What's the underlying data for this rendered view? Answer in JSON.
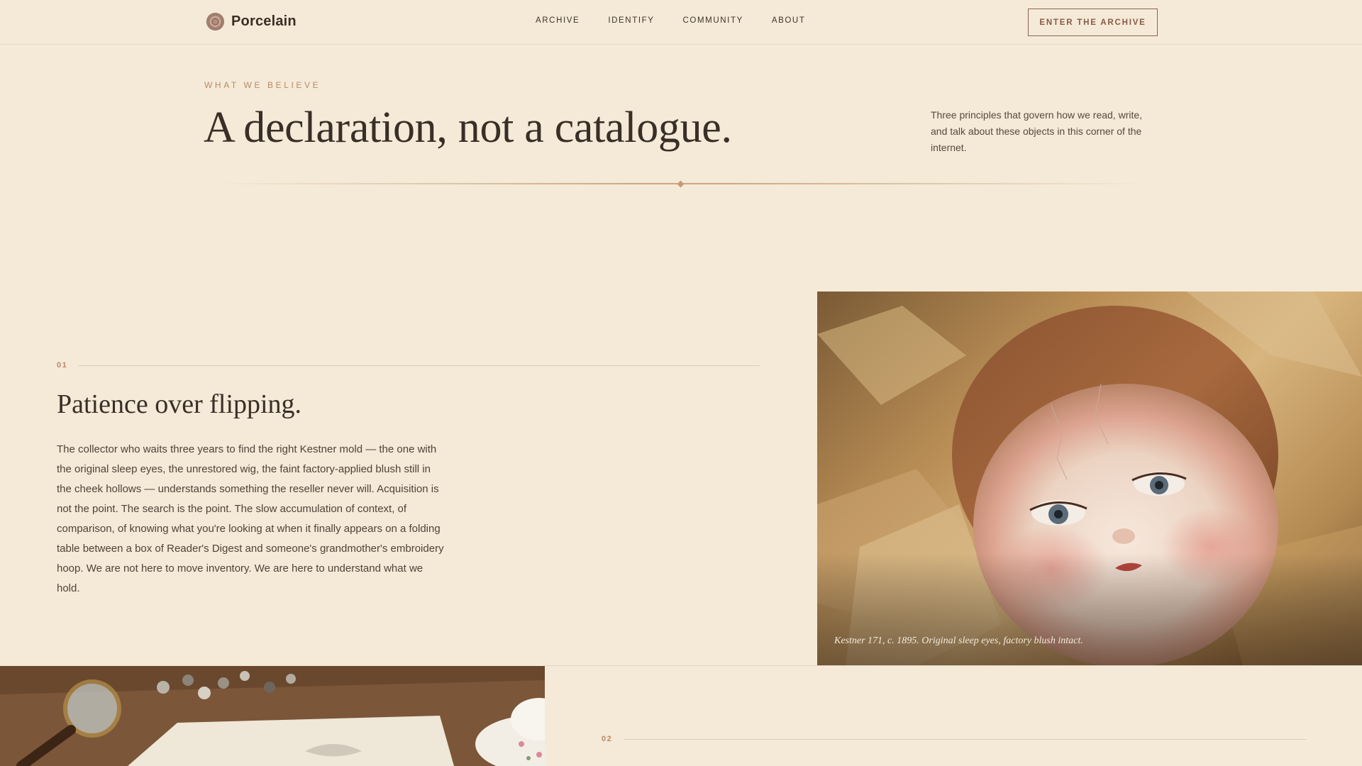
{
  "nav": {
    "brand": "Porcelain",
    "links": [
      "ARCHIVE",
      "IDENTIFY",
      "COMMUNITY",
      "ABOUT"
    ],
    "cta": "ENTER THE ARCHIVE"
  },
  "hero": {
    "eyebrow": "WHAT WE BELIEVE",
    "title": "A declaration, not a catalogue.",
    "side_text": "Three principles that govern how we read, write, and talk about these objects in this corner of the internet."
  },
  "principles": [
    {
      "number": "01",
      "title": "Patience over flipping.",
      "body": "The collector who waits three years to find the right Kestner mold — the one with the original sleep eyes, the unrestored wig, the faint factory-applied blush still in the cheek hollows — understands something the reseller never will. Acquisition is not the point. The search is the point. The slow accumulation of context, of comparison, of knowing what you're looking at when it finally appears on a folding table between a box of Reader's Digest and someone's grandmother's embroidery hoop. We are not here to move inventory. We are here to understand what we hold.",
      "image_caption": "Kestner 171, c. 1895. Original sleep eyes, factory blush intact."
    },
    {
      "number": "02"
    }
  ],
  "colors": {
    "background": "#f4ead7",
    "accent": "#b98a68",
    "text": "#3a2f27"
  }
}
